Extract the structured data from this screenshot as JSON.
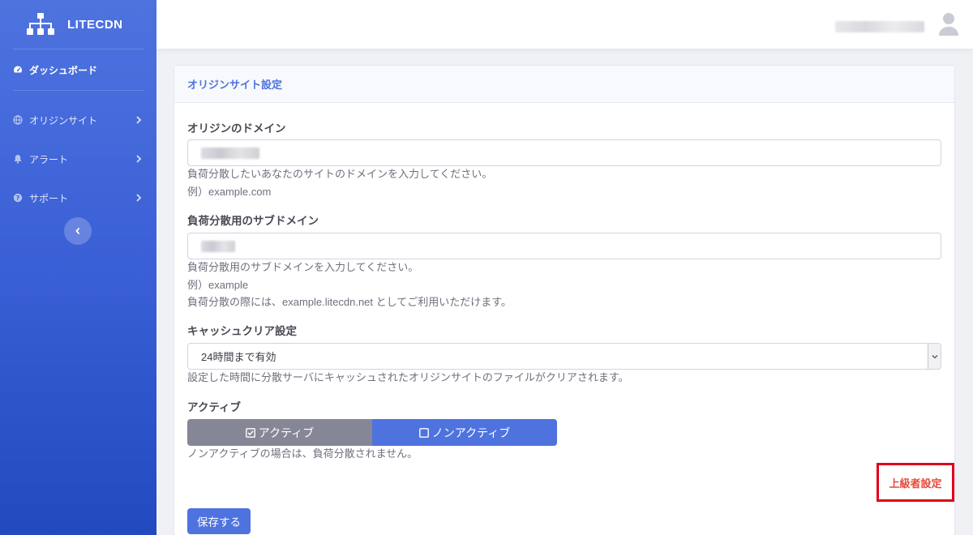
{
  "brand": {
    "name": "LITECDN"
  },
  "sidebar": {
    "items": [
      {
        "label": "ダッシュボード"
      },
      {
        "label": "オリジンサイト"
      },
      {
        "label": "アラート"
      },
      {
        "label": "サポート"
      }
    ]
  },
  "card": {
    "title": "オリジンサイト設定",
    "origin_domain": {
      "label": "オリジンのドメイン",
      "help1": "負荷分散したいあなたのサイトのドメインを入力してください。",
      "help2": "例）example.com"
    },
    "subdomain": {
      "label": "負荷分散用のサブドメイン",
      "help1": "負荷分散用のサブドメインを入力してください。",
      "help2": "例）example",
      "help3": "負荷分散の際には、example.litecdn.net としてご利用いただけます。"
    },
    "cache_clear": {
      "label": "キャッシュクリア設定",
      "selected": "24時間まで有効",
      "help": "設定した時間に分散サーバにキャッシュされたオリジンサイトのファイルがクリアされます。"
    },
    "active": {
      "label": "アクティブ",
      "option_active": "アクティブ",
      "option_inactive": "ノンアクティブ",
      "help": "ノンアクティブの場合は、負荷分散されません。"
    },
    "advanced_label": "上級者設定",
    "save_label": "保存する"
  }
}
